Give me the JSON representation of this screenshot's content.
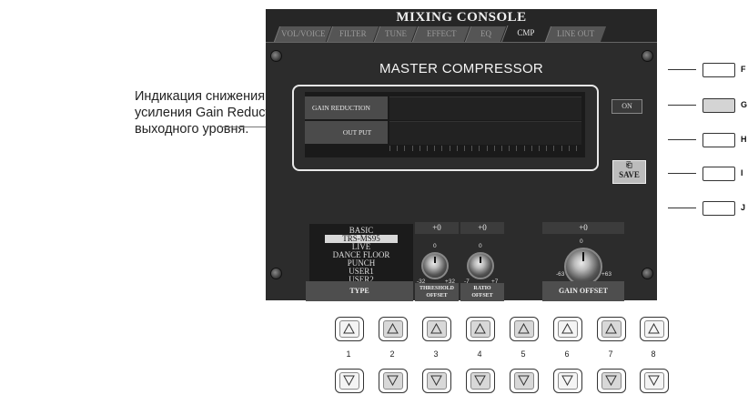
{
  "annotation": "Индикация снижения усиления Gain Reduction и выходного уровня.",
  "console": {
    "title": "MIXING CONSOLE",
    "tabs": [
      "VOL/VOICE",
      "FILTER",
      "TUNE",
      "EFFECT",
      "EQ",
      "CMP",
      "LINE OUT"
    ],
    "active_tab": "CMP",
    "section_title": "MASTER COMPRESSOR",
    "meters": {
      "gain_reduction_label": "GAIN REDUCTION",
      "output_label": "OUT PUT"
    },
    "on_button": "ON",
    "save_button": "SAVE",
    "type": {
      "items": [
        "BASIC",
        "TRS-MS95",
        "LIVE",
        "DANCE FLOOR",
        "PUNCH",
        "USER1",
        "USER2"
      ],
      "selected": "TRS-MS95",
      "label": "TYPE"
    },
    "threshold": {
      "value": "+0",
      "center": "0",
      "min": "-32",
      "max": "+32",
      "label_line1": "THRESHOLD",
      "label_line2": "OFFSET"
    },
    "ratio": {
      "value": "+0",
      "center": "0",
      "min": "-7",
      "max": "+7",
      "label_line1": "RATIO",
      "label_line2": "OFFSET"
    },
    "gain": {
      "value": "+0",
      "center": "0",
      "min": "-63",
      "max": "+63",
      "label": "GAIN OFFSET"
    }
  },
  "side_buttons": {
    "labels": [
      "F",
      "G",
      "H",
      "I",
      "J"
    ],
    "lit": "G"
  },
  "bottom_buttons": {
    "numbers": [
      "1",
      "2",
      "3",
      "4",
      "5",
      "6",
      "7",
      "8"
    ]
  },
  "colors": {
    "panel": "#262626",
    "lcd_content": "#2c2c2c",
    "highlight_frame": "#e8e8e8"
  },
  "icons": {
    "up": "triangle-up-icon",
    "down": "triangle-down-icon",
    "save": "save-icon"
  }
}
